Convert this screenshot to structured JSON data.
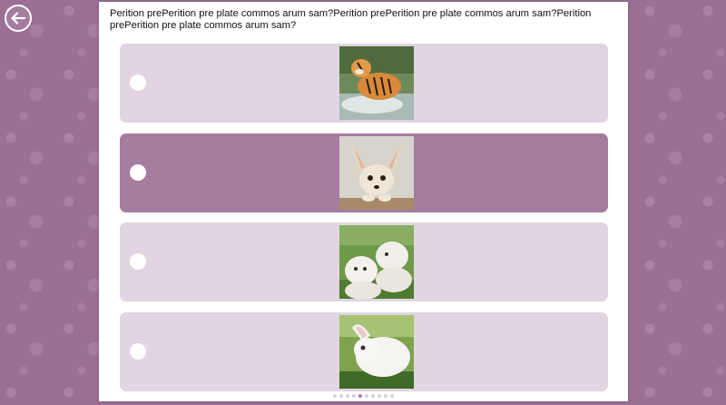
{
  "question": {
    "text": "Perition prePerition pre plate commos arum sam?Perition prePerition pre plate commos arum sam?Perition prePerition pre plate commos arum sam?"
  },
  "nav": {
    "back_icon": "arrow-left-icon"
  },
  "options": [
    {
      "image": "tiger-photo",
      "selected": false
    },
    {
      "image": "fennec-fox-photo",
      "selected": true
    },
    {
      "image": "white-lion-cubs-photo",
      "selected": false
    },
    {
      "image": "white-rabbit-photo",
      "selected": false
    }
  ],
  "pagination": {
    "total": 10,
    "current": 5
  },
  "colors": {
    "background": "#9c6f96",
    "option_bg": "#e0d5e0",
    "option_selected": "#a57d9f"
  }
}
